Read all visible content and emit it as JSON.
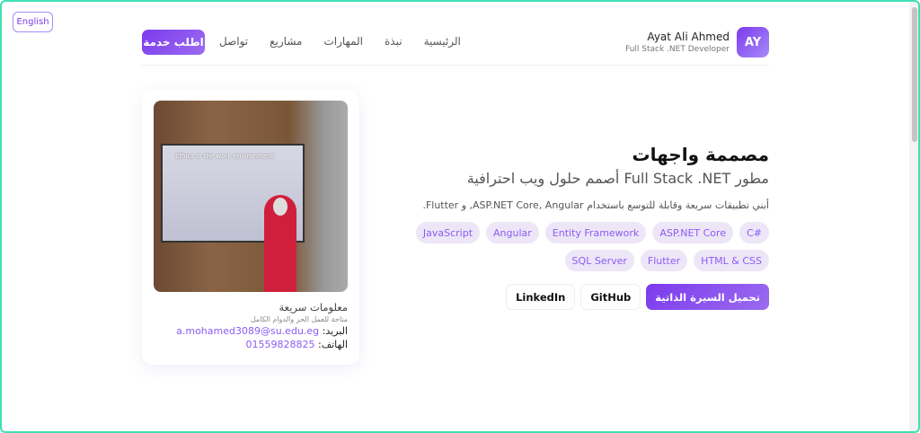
{
  "lang_toggle": "English",
  "brand": {
    "initials": "AY",
    "name": "Ayat Ali Ahmed",
    "role": "Full Stack .NET Developer"
  },
  "nav": [
    "الرئيسية",
    "نبذة",
    "المهارات",
    "مشاريع",
    "تواصل"
  ],
  "cta": "اطلب خدمة",
  "photo": {
    "slide_title": "Ethics in the work environment"
  },
  "quick_info": {
    "title": "معلومات سريعة",
    "subtitle": "متاحة للعمل الحر والدوام الكامل",
    "email_label": "البريد:",
    "email": "a.mohamed3089@su.edu.eg",
    "phone_label": "الهاتف:",
    "phone": "01559828825"
  },
  "hero": {
    "title": "مصممة واجهات",
    "subtitle": "مطور Full Stack .NET أصمم حلول ويب احترافية",
    "description": "أبني تطبيقات سريعة وقابلة للتوسع باستخدام ASP.NET Core, Angular, و Flutter.",
    "tags": [
      "C#",
      "ASP.NET Core",
      "Entity Framework",
      "Angular",
      "JavaScript",
      "HTML & CSS",
      "Flutter",
      "SQL Server"
    ],
    "buttons": {
      "cv": "تحميل السيرة الذاتية",
      "github": "GitHub",
      "linkedin": "LinkedIn"
    }
  }
}
